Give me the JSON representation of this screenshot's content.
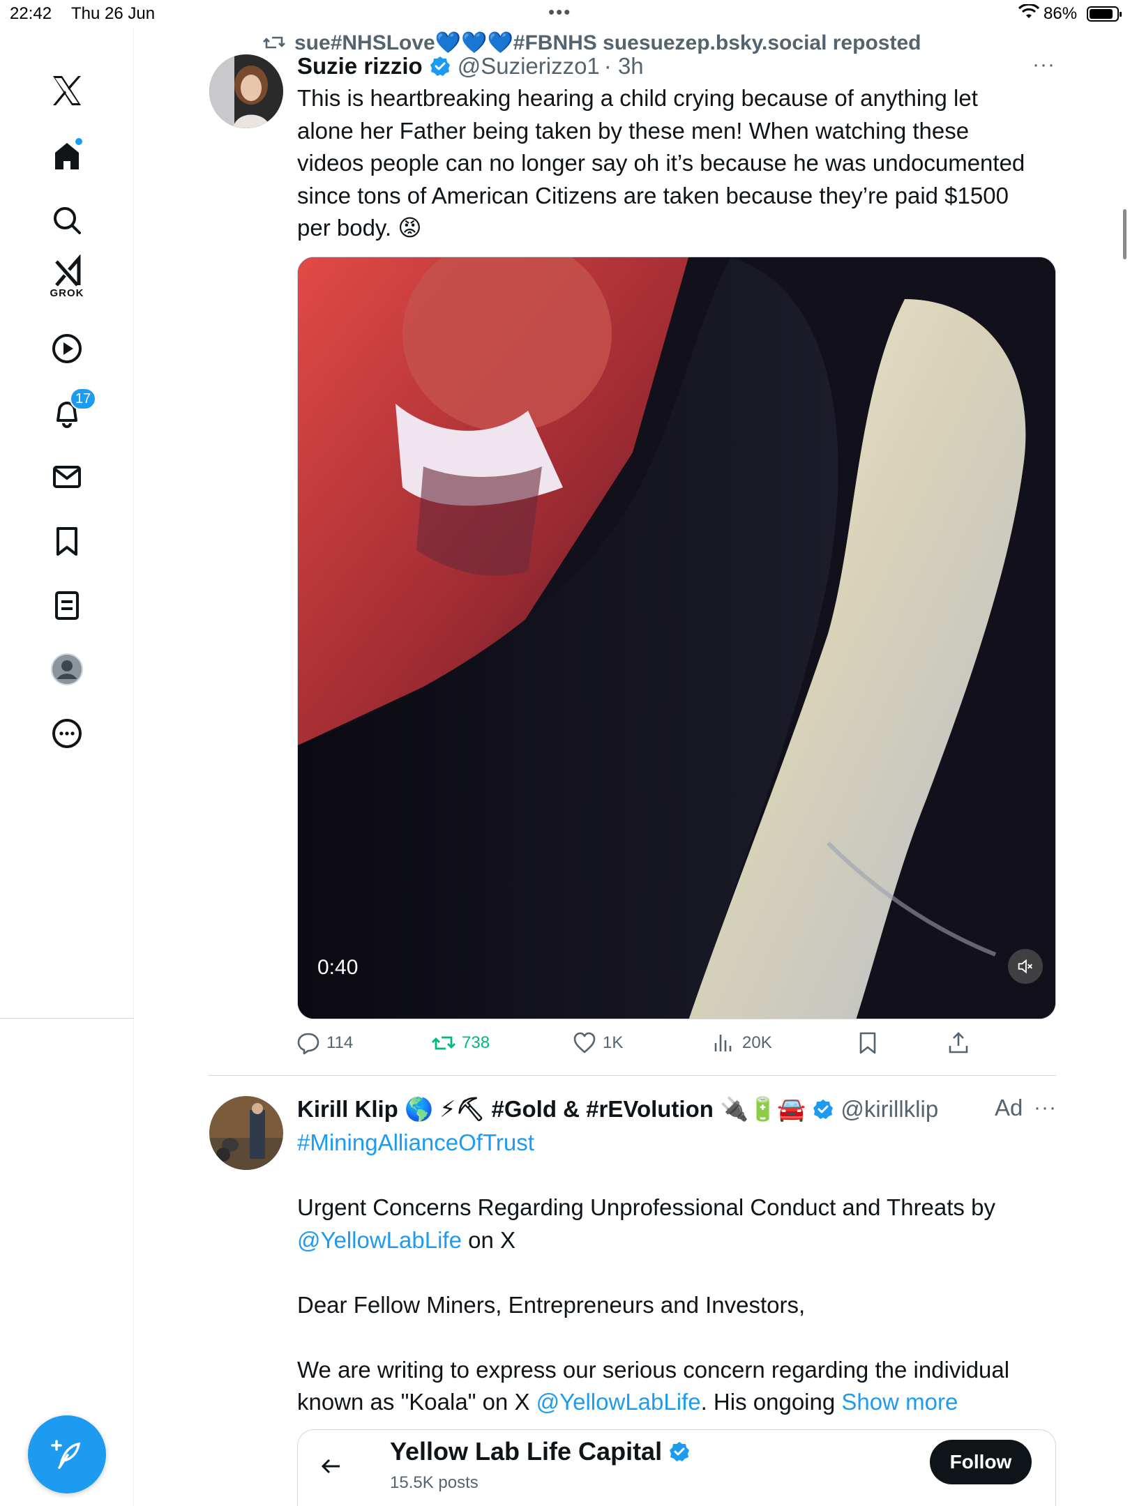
{
  "status_bar": {
    "time": "22:42",
    "date": "Thu 26 Jun",
    "battery": "86%",
    "battery_level": 0.86
  },
  "nav": {
    "grok_label": "GROK",
    "notifications_count": "17"
  },
  "repost": {
    "text": "sue#NHSLove💙💙💙#FBNHS suesuezep.bsky.social reposted"
  },
  "post1": {
    "name": "Suzie rizzio",
    "handle": "@Suzierizzo1",
    "time": "· 3h",
    "more": "···",
    "lines": [
      "This is heartbreaking hearing a child crying because of anything let",
      "alone her Father being taken by these men! When watching these",
      "videos people can no longer say oh it’s because he was undocumented",
      "since tons of American Citizens are taken because they’re paid $1500",
      "per body. 😡"
    ],
    "video_duration": "0:40",
    "actions": {
      "replies": "114",
      "reposts": "738",
      "likes": "1K",
      "views": "20K"
    }
  },
  "post2": {
    "name": "Kirill Klip 🌎 ⚡⛏ #Gold & #rEVolution 🔌🔋🚘",
    "handle": "@kirillklip",
    "ad": "Ad",
    "more": "···",
    "hashtag": "#MiningAllianceOfTrust",
    "para1_text": "Urgent Concerns Regarding Unprofessional Conduct and Threats by",
    "para1_link": "@YellowLabLife",
    "para1_tail": " on X",
    "para2": "Dear Fellow Miners, Entrepreneurs and Investors,",
    "para3_line1": "We are writing to express our serious concern regarding the individual",
    "para3_pre": "known as \"Koala\" on X ",
    "para3_link": "@YellowLabLife",
    "para3_mid": ". His ongoing ",
    "show_more": "Show more",
    "embed": {
      "title": "Yellow Lab Life Capital",
      "posts": "15.5K posts",
      "follow": "Follow"
    }
  },
  "colors": {
    "accent": "#1d9bf0",
    "repost_green": "#00ba7c",
    "text": "#0f1419",
    "muted": "#536471"
  }
}
